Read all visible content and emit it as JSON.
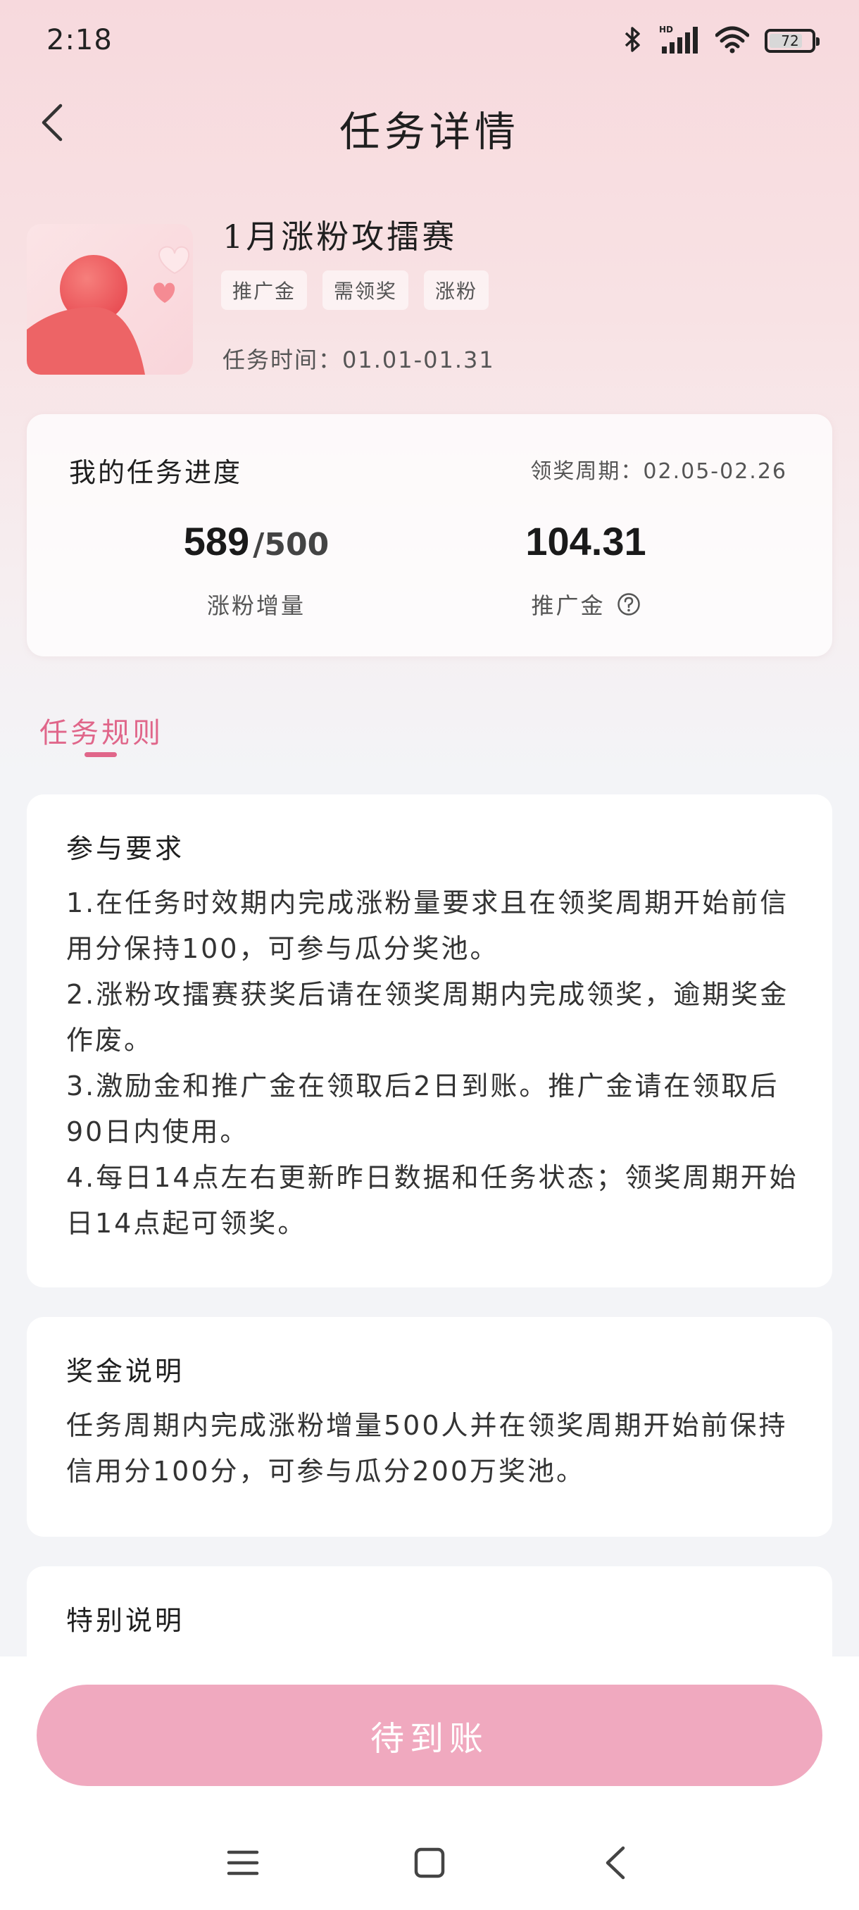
{
  "status_bar": {
    "time": "2:18",
    "battery_level": "72",
    "icons": [
      "bluetooth-icon",
      "hd-signal-icon",
      "wifi-icon",
      "battery-icon"
    ]
  },
  "header": {
    "title": "任务详情",
    "back_icon": "chevron-left-icon"
  },
  "task": {
    "name": "1月涨粉攻擂赛",
    "tags": [
      "推广金",
      "需领奖",
      "涨粉"
    ],
    "time": "任务时间：01.01-01.31"
  },
  "progress": {
    "title": "我的任务进度",
    "claim_period": "领奖周期：02.05-02.26",
    "followers_value": "589",
    "followers_target": "/500",
    "followers_label": "涨粉增量",
    "bonus_value": "104.31",
    "bonus_label": "推广金"
  },
  "tabs": {
    "rules": "任务规则"
  },
  "rules_card": {
    "title": "参与要求",
    "lines": [
      "1.在任务时效期内完成涨粉量要求且在领奖周期开始前信用分保持100，可参与瓜分奖池。",
      "2.涨粉攻擂赛获奖后请在领奖周期内完成领奖，逾期奖金作废。",
      "3.激励金和推广金在领取后2日到账。推广金请在领取后90日内使用。",
      "4.每日14点左右更新昨日数据和任务状态；领奖周期开始日14点起可领奖。"
    ]
  },
  "bonus_card": {
    "title": "奖金说明",
    "text": "任务周期内完成涨粉增量500人并在领奖周期开始前保持信用分100分，可参与瓜分200万奖池。"
  },
  "special_card": {
    "title": "特别说明"
  },
  "action": {
    "button_label": "待到账"
  },
  "nav": {
    "icons": [
      "menu-icon",
      "home-square-icon",
      "back-chevron-icon"
    ]
  },
  "colors": {
    "accent": "#e0668a",
    "button": "#f0a9bf",
    "header_gradient_top": "#f7d9dd"
  }
}
